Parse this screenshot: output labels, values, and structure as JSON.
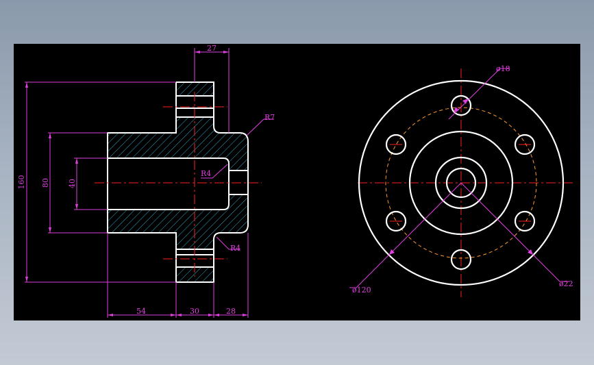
{
  "colors": {
    "background": "#000000",
    "outline": "#ffffff",
    "dimension": "#e040e0",
    "centerline": "#ff2020",
    "hatch": "#33aacc",
    "bolt_circle": "#ff9a30"
  },
  "section_view": {
    "dims": {
      "flange_thickness": "27",
      "overall_height": "160",
      "shoulder_height": "80",
      "bore": "40",
      "hub_length": "54",
      "flange_width": "30",
      "boss_length": "28"
    },
    "radii": {
      "outer_fillet": "R7",
      "inner_corner": "R4",
      "flange_fillet": "R4"
    }
  },
  "front_view": {
    "labels": {
      "hole_diameter": "ø18",
      "outer_diameter": "ø120",
      "bore_diameter": "ø22"
    }
  }
}
